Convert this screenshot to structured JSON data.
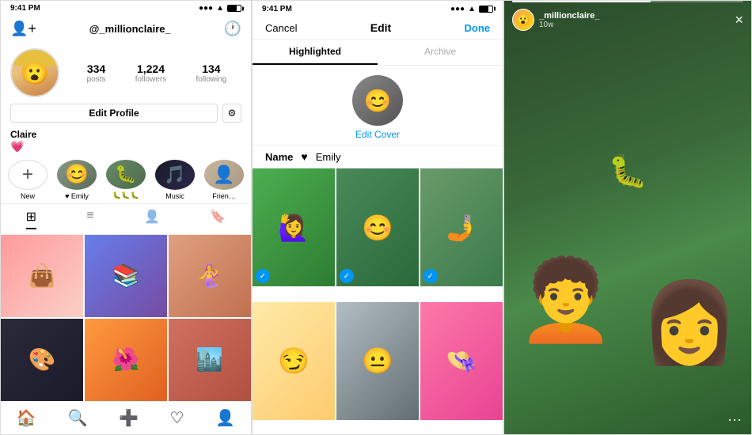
{
  "phone1": {
    "status_time": "9:41 PM",
    "username": "@_millionclaire_",
    "stats": [
      {
        "number": "334",
        "label": "posts"
      },
      {
        "number": "1,224",
        "label": "followers"
      },
      {
        "number": "134",
        "label": "following"
      }
    ],
    "edit_profile_label": "Edit Profile",
    "profile_name": "Claire",
    "profile_emoji": "💗",
    "highlights": [
      {
        "label": "New",
        "type": "new"
      },
      {
        "label": "♥ Emily",
        "type": "emoji",
        "emoji": "😊"
      },
      {
        "label": "🐛🐛🐛",
        "type": "emoji",
        "emoji": "🐛"
      },
      {
        "label": "Music",
        "type": "emoji",
        "emoji": "🎵"
      },
      {
        "label": "Frien…",
        "type": "emoji",
        "emoji": "👤"
      }
    ],
    "grid_photos": [
      {
        "bg": "cell-pink",
        "emoji": "👜"
      },
      {
        "bg": "cell-blue",
        "emoji": "📚"
      },
      {
        "bg": "cell-orange",
        "emoji": "🧜"
      },
      {
        "bg": "cell-dark",
        "emoji": "🎨"
      },
      {
        "bg": "cell-purple",
        "emoji": "🌺"
      },
      {
        "bg": "cell-brown",
        "emoji": "🏙️"
      }
    ],
    "bottom_nav": [
      "🏠",
      "🔍",
      "➕",
      "♡",
      "👤"
    ]
  },
  "phone2": {
    "status_time": "9:41 PM",
    "cancel_label": "Cancel",
    "title": "Edit",
    "done_label": "Done",
    "tabs": [
      "Highlighted",
      "Archive"
    ],
    "edit_cover_label": "Edit Cover",
    "name_label": "Name",
    "name_value": "♥ Emily",
    "stories": [
      {
        "bg": "s-green",
        "selected": true,
        "emoji": "🙋"
      },
      {
        "bg": "s-purple",
        "selected": true,
        "emoji": "😊"
      },
      {
        "bg": "s-green2",
        "selected": true,
        "emoji": "🤳"
      },
      {
        "bg": "s-floral",
        "selected": false,
        "emoji": "👒"
      },
      {
        "bg": "s-yellow",
        "selected": false,
        "emoji": "😏"
      },
      {
        "bg": "s-bw",
        "selected": false,
        "emoji": "😐"
      }
    ]
  },
  "phone3": {
    "username": "_millionclaire_",
    "time": "10w",
    "close_label": "×",
    "more_label": "···"
  }
}
